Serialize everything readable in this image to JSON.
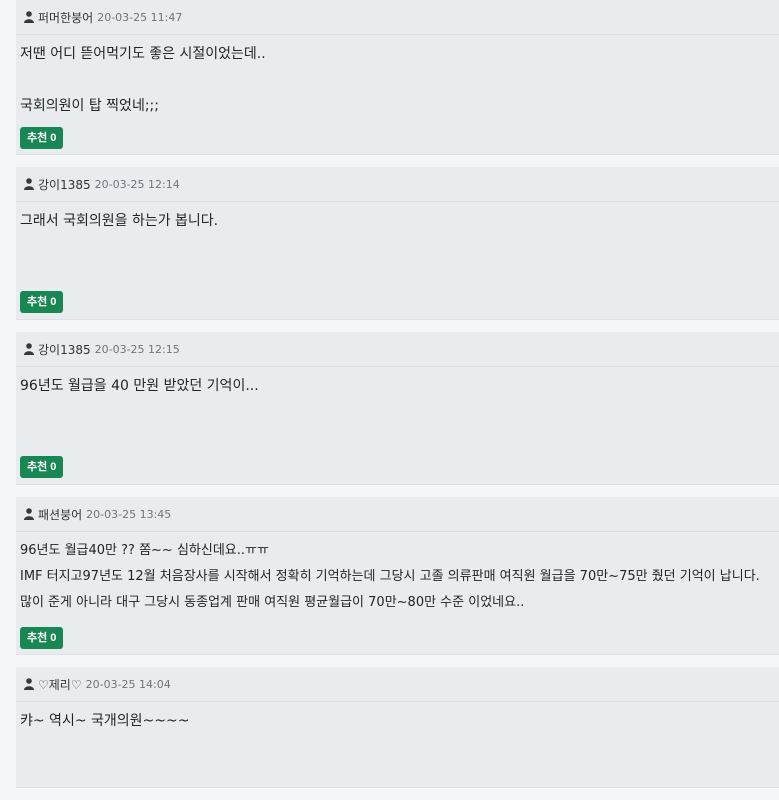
{
  "comments": [
    {
      "author": "퍼머한붕어",
      "time": "20-03-25 11:47",
      "lines": [
        "저땐 어디 뜯어먹기도 좋은 시절이었는데..",
        "",
        "국회의원이 탑 찍었네;;;"
      ],
      "recommend_label": "추천 0"
    },
    {
      "author": "강이1385",
      "time": "20-03-25 12:14",
      "lines": [
        "그래서 국회의원을 하는가 봅니다."
      ],
      "recommend_label": "추천 0"
    },
    {
      "author": "강이1385",
      "time": "20-03-25 12:15",
      "lines": [
        "96년도 월급을 40 만원 받았던 기억이..."
      ],
      "recommend_label": "추천 0"
    },
    {
      "author": "패션붕어",
      "time": "20-03-25 13:45",
      "lines": [
        "96년도 월급40만 ?? 쫌~~ 심하신데요..ㅠㅠ",
        "IMF 터지고97년도 12월 처음장사를 시작해서 정확히 기억하는데 그당시 고졸 의류판매 여직원 월급을 70만~75만 줬던 기억이 납니다.",
        "많이 준게 아니라 대구 그당시 동종업계 판매 여직원 평균월급이 70만~80만 수준 이었네요.."
      ],
      "recommend_label": "추천 0"
    },
    {
      "author": "♡제리♡",
      "time": "20-03-25 14:04",
      "lines": [
        "캬~ 역시~ 국개의원~~~~"
      ],
      "recommend_label": ""
    }
  ]
}
